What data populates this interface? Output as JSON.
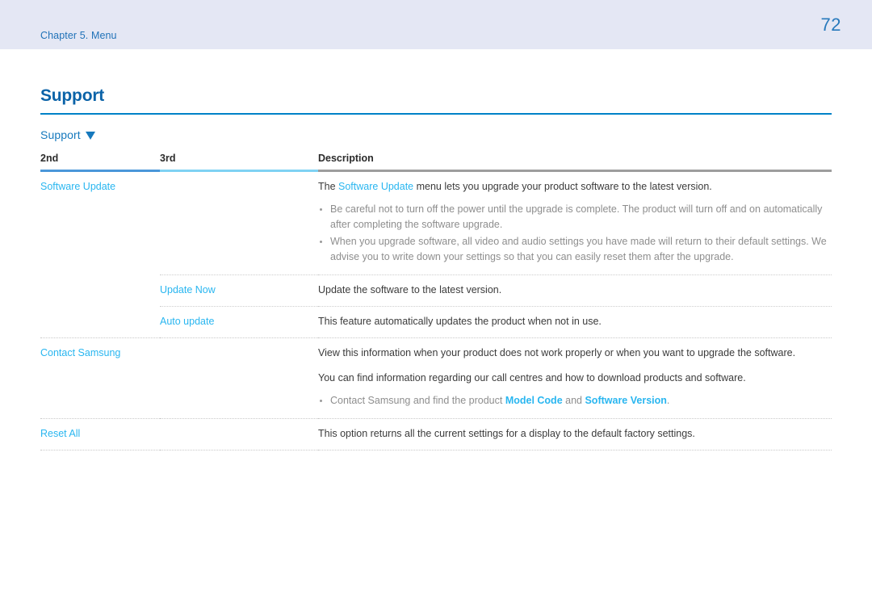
{
  "header": {
    "chapter": "Chapter 5. Menu",
    "page_number": "72",
    "background_color": "#e4e7f4",
    "text_color": "#2072b8"
  },
  "section": {
    "title": "Support",
    "rule_color": "#0082c8",
    "subsection_label": "Support",
    "subsection_icon": "caret-down-icon"
  },
  "table": {
    "columns": [
      {
        "key": "second",
        "label": "2nd",
        "underline_color": "#4a97d9"
      },
      {
        "key": "third",
        "label": "3rd",
        "underline_color": "#7fd2f3"
      },
      {
        "key": "description",
        "label": "Description",
        "underline_color": "#9d9d9d"
      }
    ],
    "rows": [
      {
        "second": "Software Update",
        "third": "",
        "description_lines": [
          "The Software Update menu lets you upgrade your product software to the latest version."
        ],
        "description_pre": "The ",
        "description_highlight": "Software Update",
        "description_post": " menu lets you upgrade your product software to the latest version.",
        "bullets": [
          "Be careful not to turn off the power until the upgrade is complete. The product will turn off and on automatically after completing the software upgrade.",
          "When you upgrade software, all video and audio settings you have made will return to their default settings. We advise you to write down your settings so that you can easily reset them after the upgrade."
        ]
      },
      {
        "second": "",
        "third": "Update Now",
        "description_lines": [
          "Update the software to the latest version."
        ],
        "bullets": []
      },
      {
        "second": "",
        "third": "Auto update",
        "description_lines": [
          "This feature automatically updates the product when not in use."
        ],
        "bullets": []
      },
      {
        "second": "Contact Samsung",
        "third": "",
        "description_lines": [
          "View this information when your product does not work properly or when you want to upgrade the software.",
          "You can find information regarding our call centres and how to download products and software."
        ],
        "bullet_parts": {
          "pre": "Contact Samsung and find the product ",
          "highlight_1": "Model Code",
          "mid": " and ",
          "highlight_2": "Software Version",
          "post": "."
        }
      },
      {
        "second": "Reset All",
        "third": "",
        "description_lines": [
          "This option returns all the current settings for a display to the default factory settings."
        ],
        "bullets": []
      }
    ]
  },
  "colors": {
    "link_blue": "#29b6f0",
    "title_blue": "#0b63a8",
    "body_gray": "#3b3b3b",
    "bullet_gray": "#8e8e8e"
  }
}
